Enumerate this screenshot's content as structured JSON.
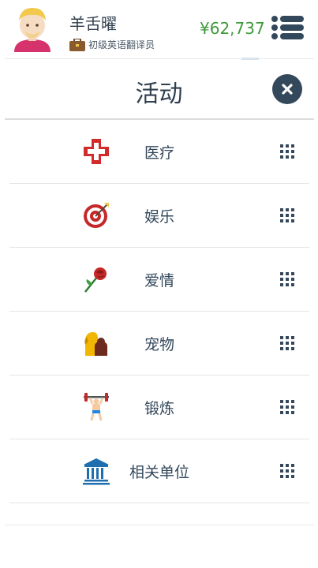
{
  "header": {
    "user_name": "羊舌曜",
    "job_title": "初级英语翻译员",
    "money": "¥62,737"
  },
  "dialog": {
    "title": "活动"
  },
  "activities": [
    {
      "label": "医疗",
      "icon": "medical-cross-icon"
    },
    {
      "label": "娱乐",
      "icon": "target-icon"
    },
    {
      "label": "爱情",
      "icon": "rose-icon"
    },
    {
      "label": "宠物",
      "icon": "pet-dog-icon"
    },
    {
      "label": "锻炼",
      "icon": "weightlifter-icon"
    },
    {
      "label": "相关单位",
      "icon": "institution-building-icon"
    }
  ],
  "colors": {
    "accent_dark": "#34485c",
    "money_green": "#3d9a3a",
    "medical_red": "#d22b2b",
    "building_blue": "#1f6fb0"
  }
}
